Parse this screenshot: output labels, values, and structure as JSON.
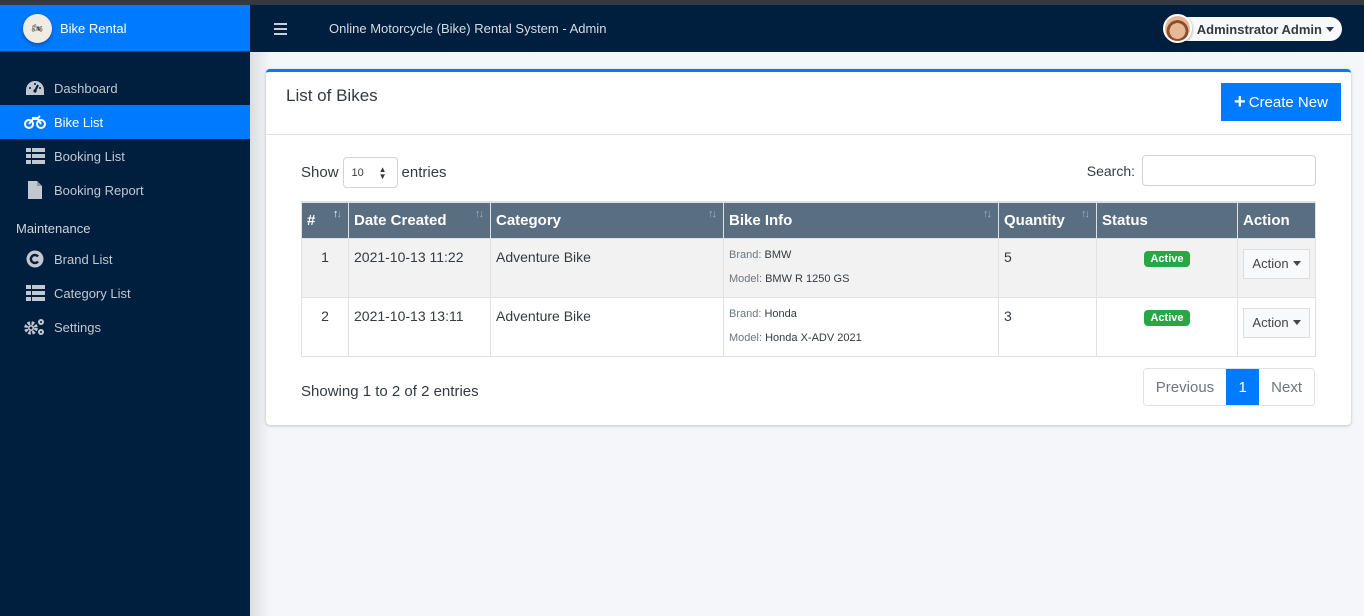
{
  "brand": {
    "name": "Bike Rental",
    "logo_icon": "motorcycle-logo-icon"
  },
  "sidebar": {
    "items": [
      {
        "label": "Dashboard",
        "icon": "tachometer-icon",
        "active": false
      },
      {
        "label": "Bike List",
        "icon": "motorcycle-icon",
        "active": true
      },
      {
        "label": "Booking List",
        "icon": "table-list-icon",
        "active": false
      },
      {
        "label": "Booking Report",
        "icon": "file-icon",
        "active": false
      }
    ],
    "section_header": "Maintenance",
    "maintenance_items": [
      {
        "label": "Brand List",
        "icon": "copyright-icon"
      },
      {
        "label": "Category List",
        "icon": "table-list-icon"
      },
      {
        "label": "Settings",
        "icon": "cogs-icon"
      }
    ]
  },
  "topbar": {
    "title": "Online Motorcycle (Bike) Rental System - Admin",
    "menu_icon": "hamburger-icon",
    "user_name": "Adminstrator Admin"
  },
  "card": {
    "title": "List of Bikes",
    "create_button": "Create New",
    "show_label": "Show",
    "entries_label": "entries",
    "page_length": "10",
    "search_label": "Search:",
    "search_value": ""
  },
  "table": {
    "columns": [
      "#",
      "Date Created",
      "Category",
      "Bike Info",
      "Quantity",
      "Status",
      "Action"
    ],
    "brand_label": "Brand:",
    "model_label": "Model:",
    "rows": [
      {
        "num": "1",
        "date": "2021-10-13 11:22",
        "category": "Adventure Bike",
        "brand": "BMW",
        "model": "BMW R 1250 GS",
        "quantity": "5",
        "status": "Active",
        "action": "Action"
      },
      {
        "num": "2",
        "date": "2021-10-13 13:11",
        "category": "Adventure Bike",
        "brand": "Honda",
        "model": "Honda X-ADV 2021",
        "quantity": "3",
        "status": "Active",
        "action": "Action"
      }
    ]
  },
  "footer": {
    "info": "Showing 1 to 2 of 2 entries",
    "previous": "Previous",
    "current_page": "1",
    "next": "Next"
  },
  "colors": {
    "primary": "#007bff",
    "sidebar": "#001f3f",
    "success": "#28a745",
    "table_header": "#5a6e82"
  }
}
